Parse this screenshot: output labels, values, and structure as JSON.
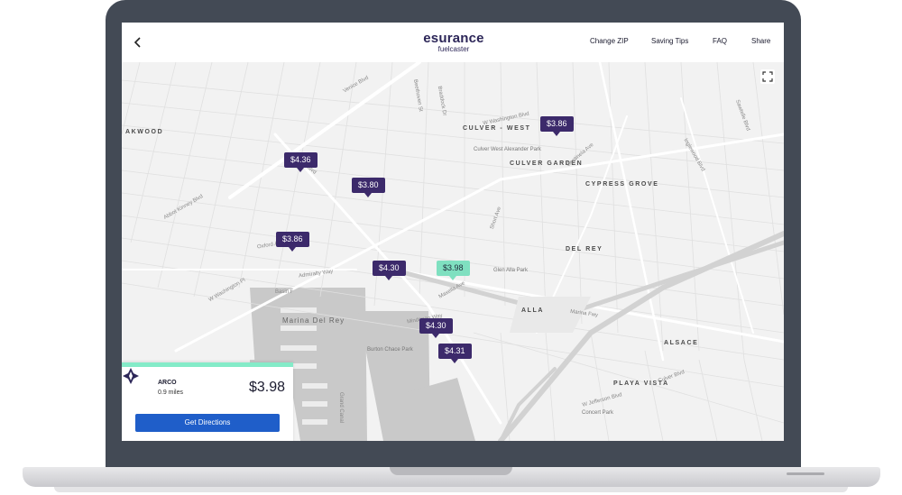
{
  "header": {
    "back_icon": "chevron-left-icon",
    "logo_main": "esurance",
    "logo_sub": "fuelcaster",
    "nav": [
      "Change ZIP",
      "Saving Tips",
      "FAQ",
      "Share"
    ]
  },
  "map": {
    "fullscreen_icon": "fullscreen-icon",
    "neighborhoods": [
      "AKWOOD",
      "CULVER - WEST",
      "CULVER GARDEN",
      "CYPRESS GROVE",
      "DEL REY",
      "ALLA",
      "ALSACE",
      "PLAYA VISTA"
    ],
    "areas": [
      "Culver West Alexander Park",
      "Glen Alla Park",
      "Marina Del Rey",
      "Burton Chace Park",
      "Concert Park"
    ],
    "streets": [
      "Venice Blvd",
      "Lincoln Blvd",
      "W Washington Blvd",
      "W Washington Pl",
      "Abbot Kinney Blvd",
      "Marina Fwy",
      "Culver Blvd",
      "Inglewood Blvd",
      "Sawtelle Blvd",
      "W Jefferson Blvd",
      "Centinela Ave",
      "Short Ave",
      "Braddock Dr",
      "Beethoven St",
      "Admiralty Way",
      "Mindanao Way",
      "Maxella Ave",
      "Grand Canal",
      "Oxford Ave",
      "Basin F"
    ],
    "prices": [
      "$3.86",
      "$4.36",
      "$3.80",
      "$3.86",
      "$4.30",
      "$3.98",
      "$4.30",
      "$4.31"
    ],
    "active_price": "$3.98"
  },
  "station": {
    "logo_icon": "arco-logo-icon",
    "name": "ARCO",
    "distance": "0.9 miles",
    "price": "$3.98",
    "button": "Get Directions"
  },
  "colors": {
    "brand": "#2c2658",
    "pin": "#3c2a6b",
    "pin_active": "#7fe0c0",
    "button": "#1f5ec9",
    "bezel": "#434a55"
  }
}
